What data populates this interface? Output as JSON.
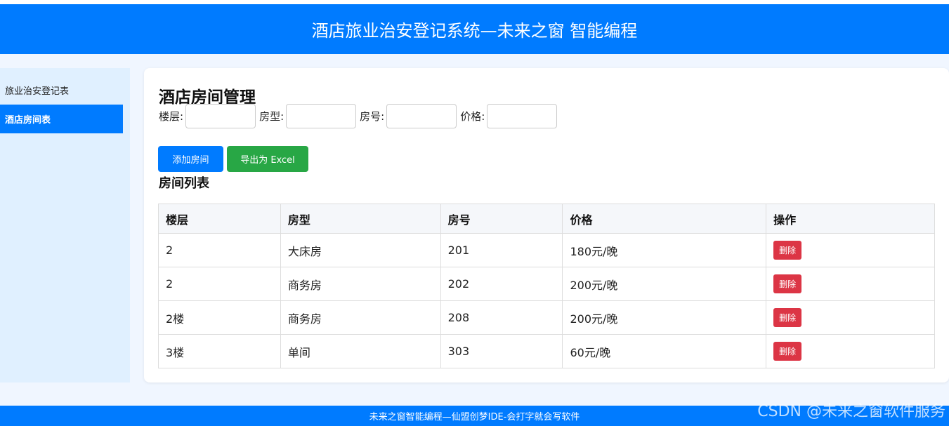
{
  "header": {
    "title": "酒店旅业治安登记系统—未来之窗 智能编程"
  },
  "sidebar": {
    "items": [
      {
        "label": "旅业治安登记表",
        "active": false
      },
      {
        "label": "酒店房间表",
        "active": true
      }
    ]
  },
  "main": {
    "title": "酒店房间管理",
    "form": {
      "floor_label": "楼层:",
      "type_label": "房型:",
      "number_label": "房号:",
      "price_label": "价格:",
      "floor_value": "",
      "type_value": "",
      "number_value": "",
      "price_value": ""
    },
    "buttons": {
      "add": "添加房间",
      "export": "导出为 Excel"
    },
    "list_title": "房间列表",
    "table": {
      "headers": [
        "楼层",
        "房型",
        "房号",
        "价格",
        "操作"
      ],
      "rows": [
        {
          "floor": "2",
          "type": "大床房",
          "number": "201",
          "price": "180元/晚",
          "action": "删除"
        },
        {
          "floor": "2",
          "type": "商务房",
          "number": "202",
          "price": "200元/晚",
          "action": "删除"
        },
        {
          "floor": "2楼",
          "type": "商务房",
          "number": "208",
          "price": "200元/晚",
          "action": "删除"
        },
        {
          "floor": "3楼",
          "type": "单间",
          "number": "303",
          "price": "60元/晚",
          "action": "删除"
        }
      ]
    }
  },
  "footer": {
    "text": "未来之窗智能编程—仙盟创梦IDE-会打字就会写软件"
  },
  "watermark": "CSDN @未来之窗软件服务",
  "colors": {
    "primary": "#007bff",
    "success": "#28a745",
    "danger": "#dc3545"
  }
}
